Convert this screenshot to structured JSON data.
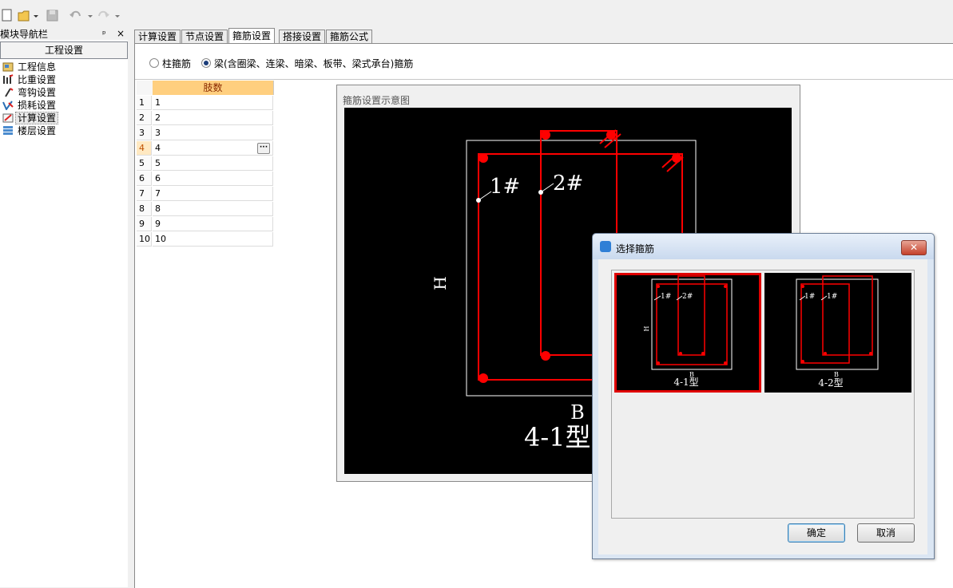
{
  "toolbar": {
    "icons": [
      "new-icon",
      "open-icon",
      "save-icon",
      "undo-icon",
      "redo-icon"
    ]
  },
  "nav": {
    "title": "模块导航栏",
    "pin": "ᵖ",
    "close": "×",
    "header": "工程设置",
    "items": [
      {
        "label": "工程信息",
        "icon": "project-info-icon"
      },
      {
        "label": "比重设置",
        "icon": "density-icon"
      },
      {
        "label": "弯钩设置",
        "icon": "hook-icon"
      },
      {
        "label": "损耗设置",
        "icon": "loss-icon"
      },
      {
        "label": "计算设置",
        "icon": "calc-icon",
        "selected": true
      },
      {
        "label": "楼层设置",
        "icon": "floor-icon"
      }
    ]
  },
  "tabs": [
    {
      "label": "计算设置"
    },
    {
      "label": "节点设置"
    },
    {
      "label": "箍筋设置",
      "active": true
    },
    {
      "label": "搭接设置"
    },
    {
      "label": "箍筋公式"
    }
  ],
  "radios": [
    {
      "label": "柱箍筋",
      "checked": false
    },
    {
      "label": "梁(含圈梁、连梁、暗梁、板带、梁式承台)箍筋",
      "checked": true
    }
  ],
  "grid": {
    "header": "肢数",
    "rows": [
      {
        "n": "1",
        "v": "1"
      },
      {
        "n": "2",
        "v": "2"
      },
      {
        "n": "3",
        "v": "3"
      },
      {
        "n": "4",
        "v": "4"
      },
      {
        "n": "5",
        "v": "5"
      },
      {
        "n": "6",
        "v": "6"
      },
      {
        "n": "7",
        "v": "7"
      },
      {
        "n": "8",
        "v": "8"
      },
      {
        "n": "9",
        "v": "9"
      },
      {
        "n": "10",
        "v": "10"
      }
    ],
    "current_row": "4",
    "ellipsis": "···"
  },
  "preview": {
    "title": "箍筋设置示意图",
    "label_1": "1#",
    "label_2": "2#",
    "label_h": "H",
    "label_b": "B",
    "type_label": "4-1型"
  },
  "dialog": {
    "title": "选择箍筋",
    "close": "✕",
    "options": [
      {
        "type_label": "4-1型",
        "l1": "1#",
        "l2": "2#",
        "h": "H",
        "b": "B",
        "selected": true
      },
      {
        "type_label": "4-2型",
        "l1": "1#",
        "l2": "1#",
        "h": "",
        "b": "B",
        "selected": false
      }
    ],
    "ok": "确定",
    "cancel": "取消"
  },
  "colors": {
    "rebar": "#ff0000",
    "frame": "#ffffff",
    "canvas": "#000000"
  }
}
